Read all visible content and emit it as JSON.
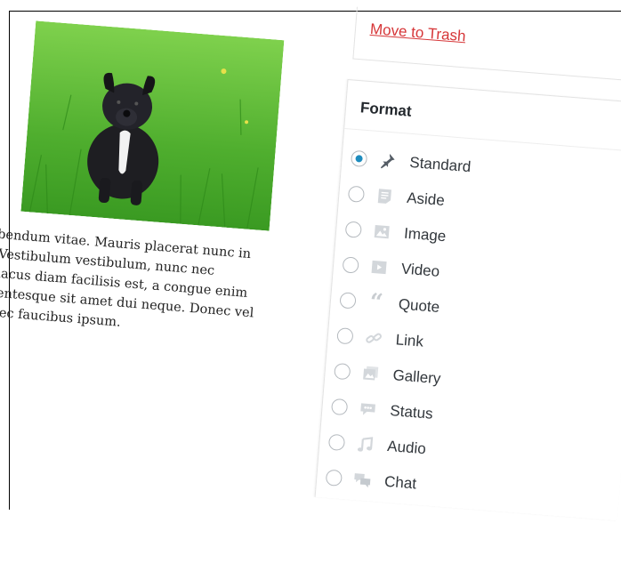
{
  "sidebar": {
    "trash_label": "Move to Trash",
    "format": {
      "title": "Format",
      "selected": "Standard",
      "options": [
        {
          "label": "Standard",
          "icon": "pin-icon"
        },
        {
          "label": "Aside",
          "icon": "aside-icon"
        },
        {
          "label": "Image",
          "icon": "image-icon"
        },
        {
          "label": "Video",
          "icon": "video-icon"
        },
        {
          "label": "Quote",
          "icon": "quote-icon"
        },
        {
          "label": "Link",
          "icon": "link-icon"
        },
        {
          "label": "Gallery",
          "icon": "gallery-icon"
        },
        {
          "label": "Status",
          "icon": "status-icon"
        },
        {
          "label": "Audio",
          "icon": "audio-icon"
        },
        {
          "label": "Chat",
          "icon": "chat-icon"
        }
      ]
    }
  },
  "editor": {
    "lines": [
      "pibendum vitae. Mauris placerat nunc in",
      "s. Vestibulum vestibulum, nunc nec",
      "s, lacus diam facilisis est, a congue enim",
      "ellentesque sit amet dui neque. Donec vel",
      "e nec faucibus ipsum."
    ]
  },
  "colors": {
    "accent": "#1e8cbe",
    "trash": "#d63638",
    "grass": "#5bbf3a"
  }
}
